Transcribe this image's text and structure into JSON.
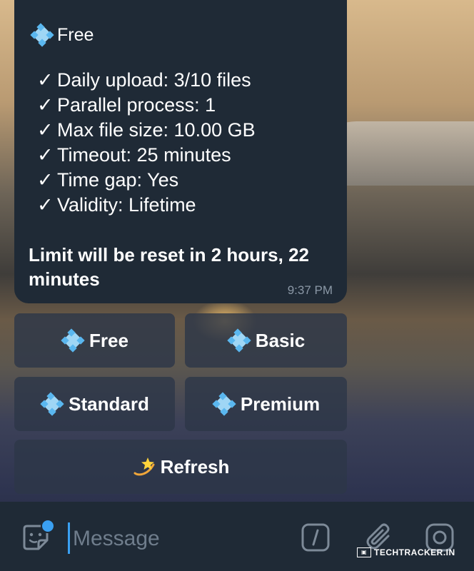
{
  "message": {
    "plan_title": "Free",
    "plan_icon": "blue-diamond-icon",
    "check_mark": "✓",
    "features": [
      "Daily upload: 3/10 files",
      "Parallel process: 1",
      "Max file size: 10.00 GB",
      "Timeout: 25 minutes",
      "Time gap: Yes",
      "Validity: Lifetime"
    ],
    "reset_text": "Limit will be reset in 2 hours, 22 minutes",
    "time": "9:37 PM"
  },
  "keyboard": {
    "free_label": "Free",
    "basic_label": "Basic",
    "standard_label": "Standard",
    "premium_label": "Premium",
    "refresh_label": "Refresh",
    "refresh_icon": "dizzy-star-icon"
  },
  "input_bar": {
    "placeholder": "Message",
    "value": ""
  },
  "watermark": "TECHTRACKER.IN",
  "colors": {
    "bubble": "#1f2a36",
    "accent": "#3aa0f2",
    "button_bg": "#2d3748",
    "timestamp": "#8b98a6"
  }
}
